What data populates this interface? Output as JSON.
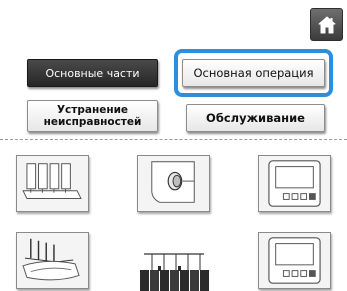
{
  "home": {
    "icon": "home-icon"
  },
  "buttons": {
    "main_parts": "Основные части",
    "basic_operation": "Основная операция",
    "troubleshooting": "Устранение\nнеисправностей",
    "maintenance": "Обслуживание"
  },
  "highlight": {
    "target": "basic_operation",
    "color": "#2c8fde"
  },
  "tiles": [
    {
      "icon": "machine-front-icon"
    },
    {
      "icon": "machine-side-knob-icon"
    },
    {
      "icon": "lcd-panel-icon"
    },
    {
      "icon": "thread-stand-icon"
    },
    {
      "icon": "lcd-panel-icon"
    }
  ]
}
